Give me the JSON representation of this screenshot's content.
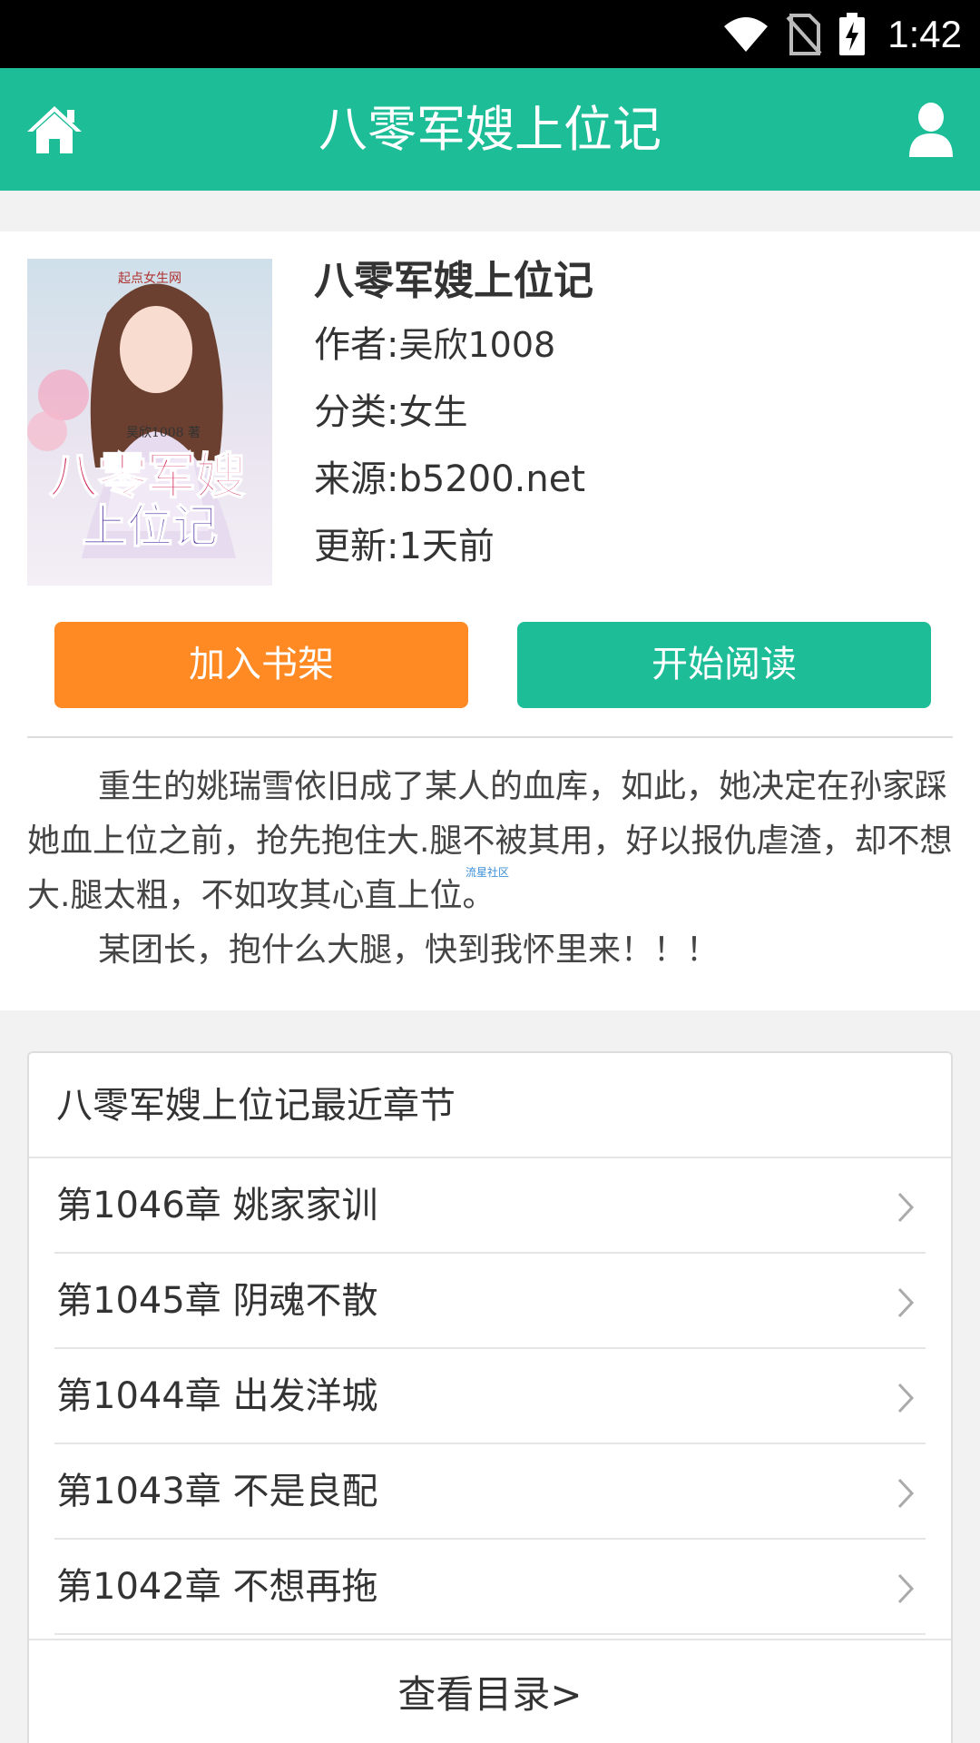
{
  "status_bar": {
    "time": "1:42",
    "icons": [
      "wifi-icon",
      "no-sim-icon",
      "battery-charging-icon"
    ]
  },
  "header": {
    "title": "八零军嫂上位记",
    "left_icon": "home-icon",
    "right_icon": "user-icon",
    "background": "#1dbd98"
  },
  "book": {
    "title": "八零军嫂上位记",
    "author_label": "作者:",
    "author": "吴欣1008",
    "category_label": "分类:",
    "category": "女生",
    "source_label": "来源:",
    "source": "b5200.net",
    "updated_label": "更新:",
    "updated": "1天前",
    "cover": {
      "title_line1": "八零军嫂",
      "title_line2": "上位记",
      "author_text": "吴欣1008 著",
      "publisher_text": "起点女生网"
    }
  },
  "actions": {
    "add_shelf": "加入书架",
    "start_reading": "开始阅读",
    "add_shelf_color": "#ff8922",
    "start_reading_color": "#1dbd98"
  },
  "intro": {
    "paragraph1": "重生的姚瑞雪依旧成了某人的血库，如此，她决定在孙家踩她血上位之前，抢先抱住大.腿不被其用，好以报仇虐渣，却不想大.腿太粗，不如攻其心直上位。",
    "paragraph2": "某团长，抱什么大腿，快到我怀里来！！！",
    "watermark": "流星社区"
  },
  "chapters": {
    "header": "八零军嫂上位记最近章节",
    "items": [
      {
        "label": "第1046章 姚家家训"
      },
      {
        "label": "第1045章 阴魂不散"
      },
      {
        "label": "第1044章 出发洋城"
      },
      {
        "label": "第1043章 不是良配"
      },
      {
        "label": "第1042章 不想再拖"
      }
    ],
    "view_toc": "查看目录>"
  }
}
